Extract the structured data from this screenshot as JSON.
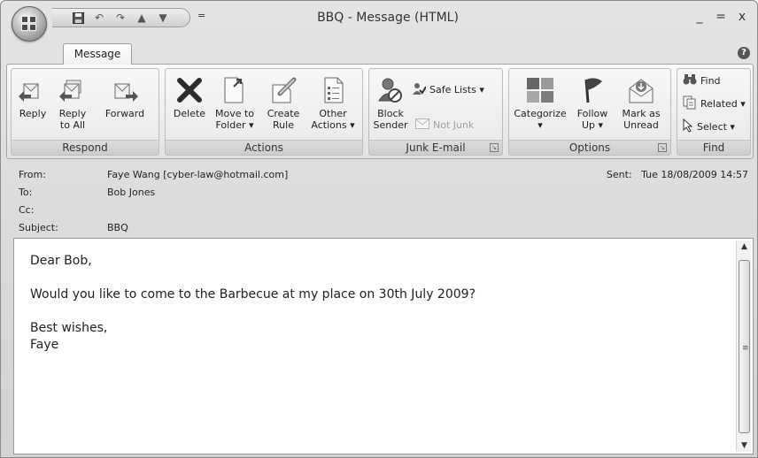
{
  "window": {
    "title": "BBQ - Message (HTML)",
    "minimize": "_",
    "maximize": "=",
    "close": "x"
  },
  "qat": {
    "dropdown": "="
  },
  "tabs": [
    {
      "label": "Message"
    }
  ],
  "ribbon": {
    "groups": {
      "respond": {
        "label": "Respond",
        "reply": "Reply",
        "reply_all_1": "Reply",
        "reply_all_2": "to All",
        "forward": "Forward"
      },
      "actions": {
        "label": "Actions",
        "delete": "Delete",
        "move_1": "Move to",
        "move_2": "Folder ▾",
        "create_1": "Create",
        "create_2": "Rule",
        "other_1": "Other",
        "other_2": "Actions ▾"
      },
      "junk": {
        "label": "Junk E-mail",
        "block_1": "Block",
        "block_2": "Sender",
        "safe_lists": "Safe Lists ▾",
        "not_junk": "Not Junk"
      },
      "options": {
        "label": "Options",
        "categorize_1": "Categorize",
        "categorize_2": "▾",
        "follow_1": "Follow",
        "follow_2": "Up ▾",
        "mark_1": "Mark as",
        "mark_2": "Unread"
      },
      "find": {
        "label": "Find",
        "find": "Find",
        "related": "Related ▾",
        "select": "Select ▾"
      }
    }
  },
  "header": {
    "from_label": "From:",
    "from_value": "Faye Wang [cyber-law@hotmail.com]",
    "to_label": "To:",
    "to_value": "Bob Jones",
    "cc_label": "Cc:",
    "cc_value": "",
    "subject_label": "Subject:",
    "subject_value": "BBQ",
    "sent_label": "Sent:",
    "sent_value": "Tue 18/08/2009 14:57"
  },
  "body": {
    "greeting": "Dear Bob,",
    "line1": "Would you like to come to the Barbecue at my place on 30th July 2009?",
    "closing": "Best wishes,",
    "signature": "Faye"
  }
}
